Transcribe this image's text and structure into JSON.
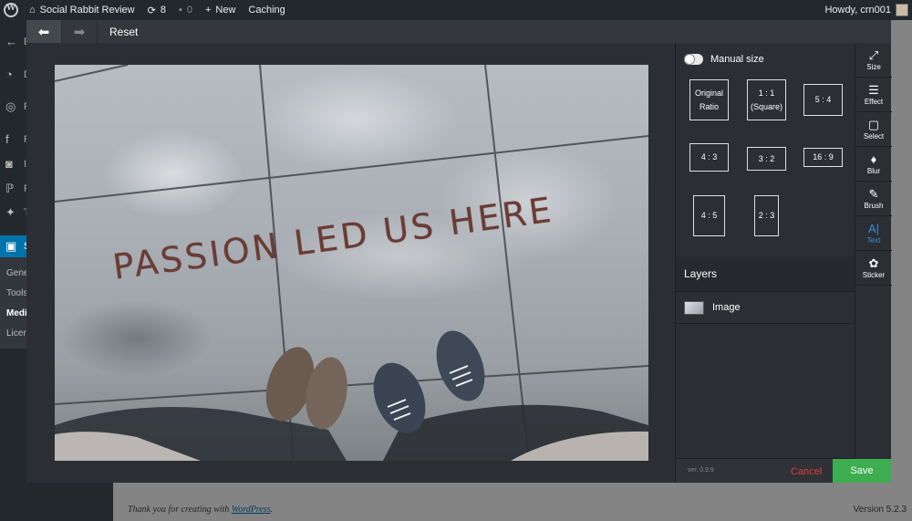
{
  "admin_bar": {
    "site_name": "Social Rabbit Review",
    "updates_count": "8",
    "comments_count": "0",
    "new_label": "New",
    "caching_label": "Caching",
    "howdy": "Howdy, crn001"
  },
  "sidebar": {
    "items": [
      {
        "label": "D",
        "icon": "dashboard-icon"
      },
      {
        "label": "P",
        "icon": "posts-icon"
      },
      {
        "label": "F",
        "icon": "facebook-icon"
      },
      {
        "label": "I",
        "icon": "instagram-icon"
      },
      {
        "label": "P",
        "icon": "pinterest-icon"
      },
      {
        "label": "T",
        "icon": "twitter-icon"
      },
      {
        "label": "S",
        "icon": "plugin-icon"
      }
    ],
    "submenu": [
      "Gene",
      "Tools",
      "Medi",
      "Licen"
    ]
  },
  "editor": {
    "reset_label": "Reset",
    "canvas_text": "PASSION LED US HERE",
    "manual_size_label": "Manual size",
    "ratios": [
      {
        "label": "Original Ratio"
      },
      {
        "label": "1 : 1 (Square)"
      },
      {
        "label": "5 : 4"
      },
      {
        "label": "4 : 3"
      },
      {
        "label": "3 : 2"
      },
      {
        "label": "16 : 9"
      },
      {
        "label": "4 : 5"
      },
      {
        "label": "2 : 3"
      }
    ],
    "layers_title": "Layers",
    "layer_name": "Image",
    "version": "ver. 0.9.9",
    "cancel_label": "Cancel",
    "save_label": "Save",
    "tools": [
      {
        "label": "Size",
        "icon": "size-icon"
      },
      {
        "label": "Effect",
        "icon": "effect-icon"
      },
      {
        "label": "Select",
        "icon": "select-icon"
      },
      {
        "label": "Blur",
        "icon": "blur-icon"
      },
      {
        "label": "Brush",
        "icon": "brush-icon"
      },
      {
        "label": "Text",
        "icon": "text-icon",
        "active": true
      },
      {
        "label": "Sticker",
        "icon": "sticker-icon"
      }
    ]
  },
  "footer": {
    "thanks_prefix": "Thank you for creating with ",
    "wordpress_link": "WordPress",
    "thanks_suffix": ".",
    "version": "Version 5.2.3"
  },
  "colors": {
    "accent_green": "#3dae4f",
    "cancel_red": "#e43d3d",
    "active_tool_blue": "#3b8ddb",
    "admin_dark": "#23282d"
  }
}
